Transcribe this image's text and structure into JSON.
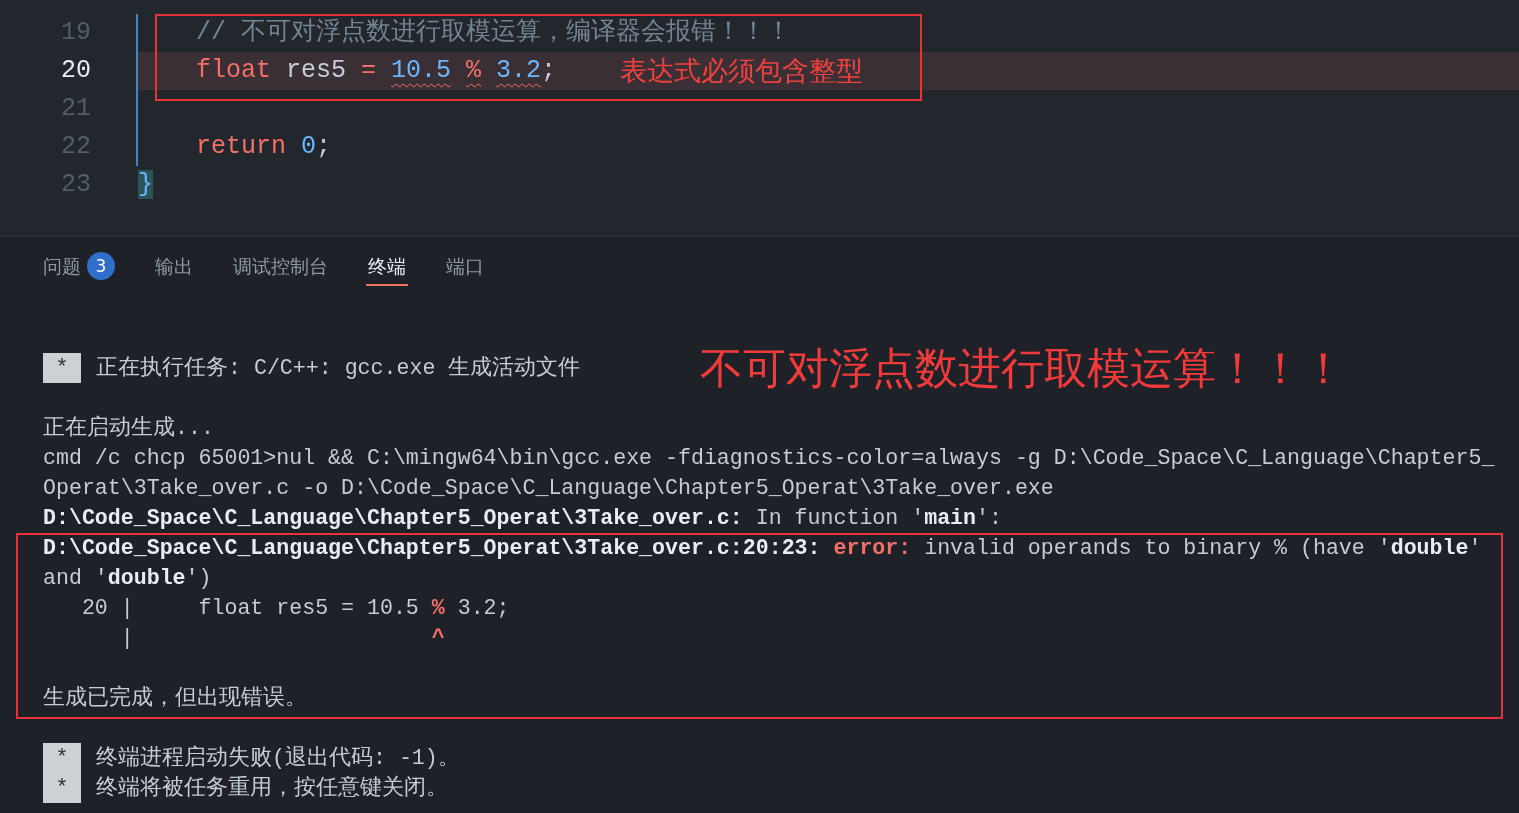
{
  "editor": {
    "lines": [
      {
        "number": "19",
        "current": false,
        "indented": true,
        "boxed": true,
        "tokens": [
          {
            "text": "// 不可对浮点数进行取模运算，编译器会报错！！！",
            "kind": "comment",
            "squiggle": false,
            "matched": false
          }
        ]
      },
      {
        "number": "20",
        "current": true,
        "indented": true,
        "boxed": true,
        "tokens": [
          {
            "text": "float",
            "kind": "keyword",
            "squiggle": false,
            "matched": false
          },
          {
            "text": "res5",
            "kind": "identifier",
            "squiggle": false,
            "matched": false
          },
          {
            "text": "=",
            "kind": "operator",
            "squiggle": false,
            "matched": false
          },
          {
            "text": "10.5",
            "kind": "number",
            "squiggle": true,
            "matched": false
          },
          {
            "text": "%",
            "kind": "operator",
            "squiggle": true,
            "matched": false
          },
          {
            "text": "3.2",
            "kind": "number",
            "squiggle": true,
            "matched": false
          },
          {
            "text": ";",
            "kind": "punctuation",
            "squiggle": false,
            "matched": false
          }
        ],
        "annotation": "表达式必须包含整型"
      },
      {
        "number": "21",
        "current": false,
        "indented": true,
        "boxed": false
      },
      {
        "number": "22",
        "current": false,
        "indented": true,
        "boxed": false,
        "tokens": [
          {
            "text": "return",
            "kind": "keyword",
            "squiggle": false,
            "matched": false
          },
          {
            "text": "0",
            "kind": "number",
            "squiggle": false,
            "matched": false
          },
          {
            "text": ";",
            "kind": "punctuation",
            "squiggle": false,
            "matched": false
          }
        ]
      },
      {
        "number": "23",
        "current": false,
        "indented": false,
        "boxed": false,
        "tokens": [
          {
            "text": "}",
            "kind": "bracket",
            "squiggle": false,
            "matched": true
          }
        ]
      }
    ]
  },
  "panel": {
    "tabs": [
      {
        "label": "问题",
        "badge": "3",
        "selected": false
      },
      {
        "label": "输出",
        "selected": false
      },
      {
        "label": "调试控制台",
        "selected": false
      },
      {
        "label": "终端",
        "selected": true
      },
      {
        "label": "端口",
        "selected": false
      }
    ]
  },
  "terminal": {
    "lines": [
      {
        "kind": "marked",
        "marker": "*",
        "boxed": false,
        "segments": [
          {
            "kind": "plain",
            "text": "正在执行任务: C/C++: gcc.exe 生成活动文件"
          }
        ],
        "annotation": "不可对浮点数进行取模运算！！！"
      },
      {
        "kind": "blank",
        "boxed": false
      },
      {
        "kind": "output",
        "boxed": false,
        "segments": [
          {
            "kind": "plain",
            "text": "正在启动生成..."
          }
        ]
      },
      {
        "kind": "output",
        "boxed": false,
        "segments": [
          {
            "kind": "plain",
            "text": "cmd /c chcp 65001>nul && C:\\mingw64\\bin\\gcc.exe -fdiagnostics-color=always -g D:\\Code_Space\\C_Language\\Chapter5_"
          }
        ]
      },
      {
        "kind": "output",
        "boxed": false,
        "segments": [
          {
            "kind": "plain",
            "text": "Operat\\3Take_over.c -o D:\\Code_Space\\C_Language\\Chapter5_Operat\\3Take_over.exe"
          }
        ]
      },
      {
        "kind": "output",
        "boxed": false,
        "segments": [
          {
            "kind": "bold",
            "text": "D:\\Code_Space\\C_Language\\Chapter5_Operat\\3Take_over.c:"
          },
          {
            "kind": "plain",
            "text": " In function '"
          },
          {
            "kind": "bold",
            "text": "main"
          },
          {
            "kind": "plain",
            "text": "':"
          }
        ]
      },
      {
        "kind": "output",
        "boxed": true,
        "segments": [
          {
            "kind": "bold",
            "text": "D:\\Code_Space\\C_Language\\Chapter5_Operat\\3Take_over.c:20:23:"
          },
          {
            "kind": "error",
            "text": " error:"
          },
          {
            "kind": "plain",
            "text": " invalid operands to binary % (have '"
          },
          {
            "kind": "bold",
            "text": "double"
          },
          {
            "kind": "plain",
            "text": "'"
          }
        ]
      },
      {
        "kind": "output",
        "boxed": true,
        "segments": [
          {
            "kind": "plain",
            "text": "and '"
          },
          {
            "kind": "bold",
            "text": "double"
          },
          {
            "kind": "plain",
            "text": "')"
          }
        ]
      },
      {
        "kind": "output",
        "boxed": true,
        "segments": [
          {
            "kind": "plain",
            "text": "   20 |     float res5 = 10.5 "
          },
          {
            "kind": "error",
            "text": "%"
          },
          {
            "kind": "plain",
            "text": " 3.2;"
          }
        ]
      },
      {
        "kind": "output",
        "boxed": true,
        "segments": [
          {
            "kind": "plain",
            "text": "      |                       "
          },
          {
            "kind": "error",
            "text": "^"
          }
        ]
      },
      {
        "kind": "blank",
        "boxed": true
      },
      {
        "kind": "output",
        "boxed": true,
        "segments": [
          {
            "kind": "plain",
            "text": "生成已完成，但出现错误。"
          }
        ]
      },
      {
        "kind": "blank",
        "boxed": false
      },
      {
        "kind": "marked",
        "marker": "*",
        "boxed": false,
        "segments": [
          {
            "kind": "plain",
            "text": "终端进程启动失败(退出代码: -1)。"
          }
        ]
      },
      {
        "kind": "marked",
        "marker": "*",
        "boxed": false,
        "segments": [
          {
            "kind": "plain",
            "text": "终端将被任务重用，按任意键关闭。"
          }
        ]
      }
    ]
  }
}
